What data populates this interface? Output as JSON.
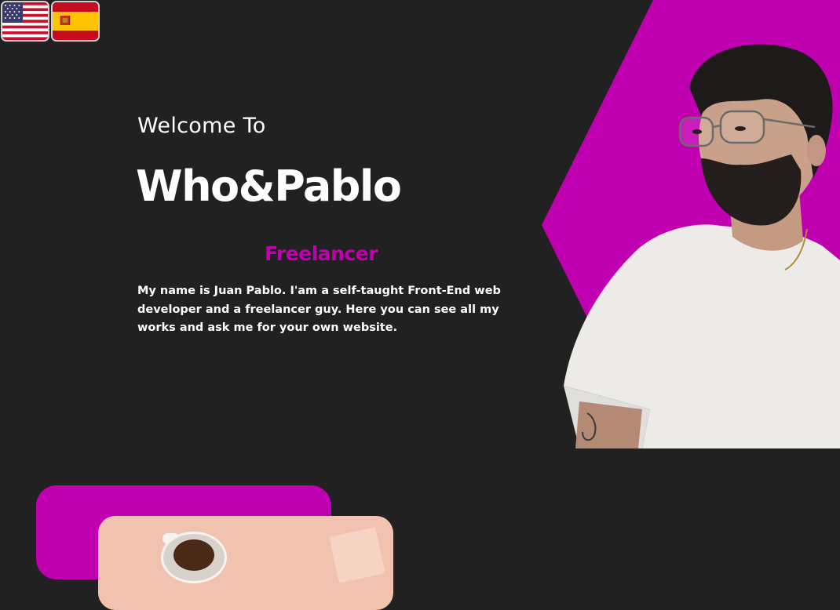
{
  "language_switcher": {
    "options": [
      {
        "icon": "us-flag-icon"
      },
      {
        "icon": "spain-flag-icon"
      }
    ]
  },
  "hero": {
    "welcome": "Welcome To",
    "brand": "Who&Pablo",
    "role": "Freelancer",
    "intro": "My name is Juan Pablo. I'am a self-taught Front-End web developer and a freelancer guy. Here you can see all my works and ask me for your own website.",
    "accent_color": "#c000b0"
  },
  "colors": {
    "background": "#212121",
    "accent": "#c000b0",
    "card_photo": "#f2c2b0"
  }
}
